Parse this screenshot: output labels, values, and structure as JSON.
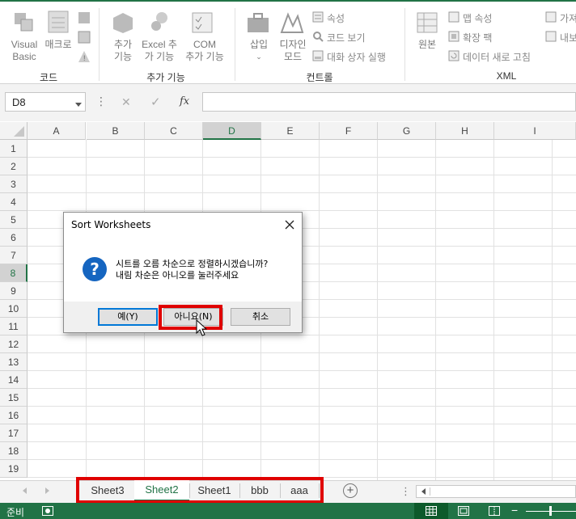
{
  "ribbon": {
    "groups": [
      {
        "label": "코드"
      },
      {
        "label": "추가 기능"
      },
      {
        "label": "컨트롤"
      },
      {
        "label": "XML"
      }
    ],
    "visual_basic": [
      "Visual",
      "Basic"
    ],
    "macro": "매크로",
    "addins": [
      "추가",
      "기능"
    ],
    "excel_addins": [
      "Excel 추",
      "가 기능"
    ],
    "com_addins": [
      "COM",
      "추가 기능"
    ],
    "insert": "삽입",
    "design_mode": [
      "디자인",
      "모드"
    ],
    "properties": "속성",
    "view_code": "코드 보기",
    "run_dialog": "대화 상자 실행",
    "source": "원본",
    "map_properties": "맵 속성",
    "expansion_packs": "확장 팩",
    "refresh_data": "데이터 새로 고침",
    "import_cut": "가져",
    "export_cut": "내보"
  },
  "formula_bar": {
    "name_box": "D8",
    "cancel_glyph": "✕",
    "enter_glyph": "✓",
    "fx": "fx",
    "value": ""
  },
  "grid": {
    "columns": [
      "A",
      "B",
      "C",
      "D",
      "E",
      "F",
      "G",
      "H",
      "I"
    ],
    "rows": [
      "1",
      "2",
      "3",
      "4",
      "5",
      "6",
      "7",
      "8",
      "9",
      "10",
      "11",
      "12",
      "13",
      "14",
      "15",
      "16",
      "17",
      "18",
      "19"
    ],
    "active_column": "D",
    "active_row": "8"
  },
  "dialog": {
    "title": "Sort Worksheets",
    "line1": "시트를 오름 차순으로 정렬하시겠습니까?",
    "line2": "내림 차순은 아니오를 눌러주세요",
    "yes": "예(Y)",
    "no": "아니요(N)",
    "cancel": "취소"
  },
  "sheets": {
    "tabs": [
      "Sheet3",
      "Sheet2",
      "Sheet1",
      "bbb",
      "aaa"
    ],
    "active": "Sheet2",
    "add_glyph": "+"
  },
  "status": {
    "ready": "준비"
  },
  "colors": {
    "excel_green": "#217346",
    "highlight_red": "#e00000",
    "info_blue": "#1565c0"
  }
}
